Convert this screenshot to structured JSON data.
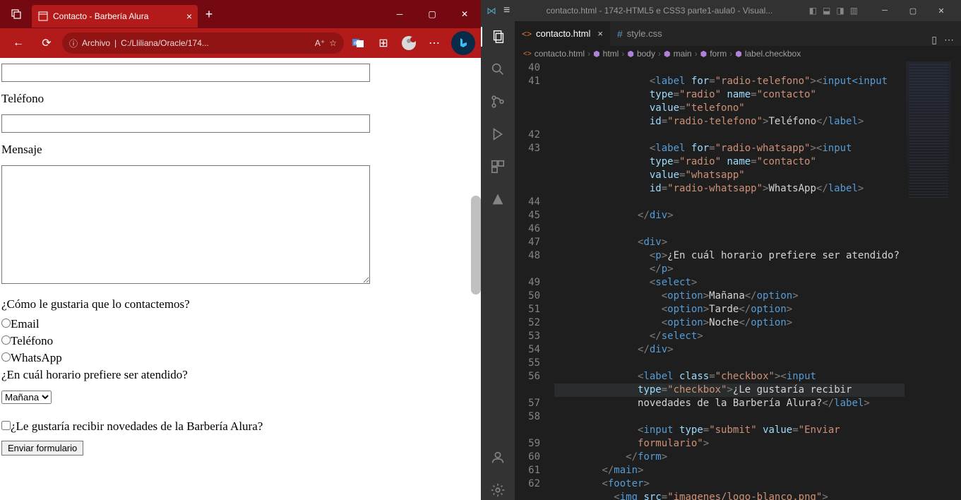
{
  "browser": {
    "tab_title": "Contacto - Barbería Alura",
    "url_label_1": "Archivo",
    "url_label_2": "C:/Lliliana/Oracle/174..."
  },
  "form": {
    "telefono_label": "Teléfono",
    "mensaje_label": "Mensaje",
    "contact_question": "¿Cómo le gustaria que lo contactemos?",
    "opt_email": "Email",
    "opt_telefono": "Teléfono",
    "opt_whatsapp": "WhatsApp",
    "horario_question": "¿En cuál horario prefiere ser atendido?",
    "horario_options": [
      "Mañana",
      "Tarde",
      "Noche"
    ],
    "newsletter_label": "¿Le gustaría recibir novedades de la Barbería Alura?",
    "submit_label": "Enviar formulario"
  },
  "vscode": {
    "title": "contacto.html - 1742-HTML5 e CSS3 parte1-aula0 - Visual...",
    "tabs": {
      "contacto": "contacto.html",
      "style": "style.css"
    },
    "breadcrumb": [
      "contacto.html",
      "html",
      "body",
      "main",
      "form",
      "label.checkbox"
    ],
    "line_numbers": [
      "40",
      "41",
      "",
      "",
      "",
      "42",
      "43",
      "",
      "",
      "",
      "44",
      "45",
      "46",
      "47",
      "48",
      "",
      "49",
      "50",
      "51",
      "52",
      "53",
      "54",
      "55",
      "56",
      "",
      "57",
      "58",
      "",
      "59",
      "60",
      "61",
      "62"
    ],
    "code_tokens": {
      "label": "label",
      "for": "for",
      "radio_tel": "\"radio-telefono\"",
      "input": "input",
      "type": "type",
      "radio": "\"radio\"",
      "name": "name",
      "contacto": "\"contacto\"",
      "value": "value",
      "telefono": "\"telefono\"",
      "id": "id",
      "txt_tel": "Teléfono",
      "radio_wa": "\"radio-whatsapp\"",
      "whatsapp": "\"whatsapp\"",
      "txt_wa": "WhatsApp",
      "div": "div",
      "p": "p",
      "q_horario": "¿En cuál horario prefiere ser atendido?",
      "select": "select",
      "option": "option",
      "manana": "Mañana",
      "tarde": "Tarde",
      "noche": "Noche",
      "class": "class",
      "checkbox": "\"checkbox\"",
      "chk": "\"checkbox\"",
      "q_news": "¿Le gustaría recibir ",
      "q_news2": "novedades de la Barbería Alura?",
      "submit": "\"submit\"",
      "enviar": "\"Enviar ",
      "formulario": "formulario\"",
      "form": "form",
      "main": "main",
      "footer": "footer",
      "img": "img",
      "src": "src",
      "logo": "\"imagenes/logo-blanco.png\""
    }
  }
}
